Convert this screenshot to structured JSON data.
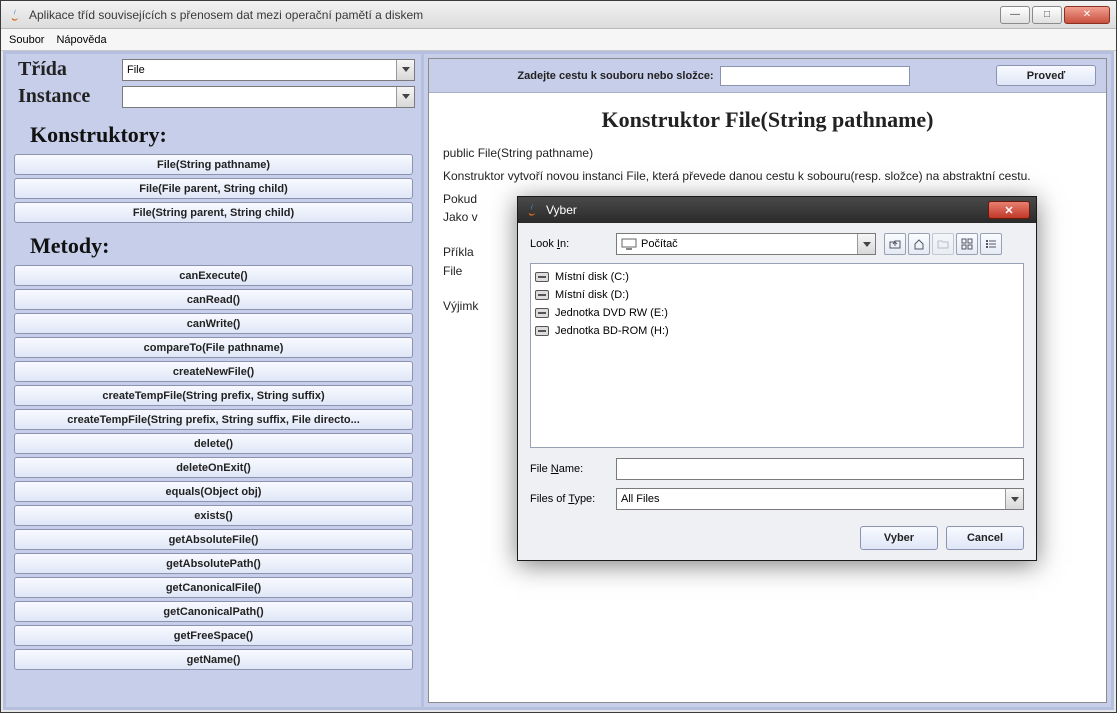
{
  "window": {
    "title": "Aplikace tříd souvisejících s přenosem dat mezi operační pamětí a diskem"
  },
  "menubar": {
    "items": [
      "Soubor",
      "Nápověda"
    ]
  },
  "leftPanel": {
    "classLabel": "Třída",
    "instanceLabel": "Instance",
    "classValue": "File",
    "instanceValue": "",
    "constructorsHeader": "Konstruktory:",
    "methodsHeader": "Metody:",
    "constructors": [
      "File(String pathname)",
      "File(File parent, String child)",
      "File(String parent, String child)"
    ],
    "methods": [
      "canExecute()",
      "canRead()",
      "canWrite()",
      "compareTo(File pathname)",
      "createNewFile()",
      "createTempFile(String prefix, String suffix)",
      "createTempFile(String prefix, String suffix, File directo...",
      "delete()",
      "deleteOnExit()",
      "equals(Object obj)",
      "exists()",
      "getAbsoluteFile()",
      "getAbsolutePath()",
      "getCanonicalFile()",
      "getCanonicalPath()",
      "getFreeSpace()",
      "getName()"
    ]
  },
  "rightPanel": {
    "prompt": "Zadejte cestu k souboru nebo složce:",
    "goLabel": "Proveď",
    "pathValue": "",
    "doc": {
      "heading": "Konstruktor File(String pathname)",
      "signature": "public File(String pathname)",
      "para1": "Konstruktor vytvoří novou instanci File, která převede danou cestu k sobouru(resp. složce) na abstraktní cestu.",
      "para2a": "Pokud",
      "para2b": "Jako v",
      "para3a": "Příkla",
      "para3b": "File",
      "para4": "Výjimk"
    }
  },
  "dialog": {
    "title": "Vyber",
    "lookInLabelPre": "Look ",
    "lookInLabelU": "I",
    "lookInLabelPost": "n:",
    "lookInValue": "Počítač",
    "fileNameLabelPre": "File ",
    "fileNameLabelU": "N",
    "fileNameLabelPost": "ame:",
    "fileNameValue": "",
    "filesTypeLabelPre": "Files of ",
    "filesTypeLabelU": "T",
    "filesTypeLabelPost": "ype:",
    "filesTypeValue": "All Files",
    "okLabel": "Vyber",
    "cancelLabel": "Cancel",
    "drives": [
      "Místní disk (C:)",
      "Místní disk (D:)",
      "Jednotka DVD RW (E:)",
      "Jednotka BD-ROM (H:)"
    ]
  }
}
